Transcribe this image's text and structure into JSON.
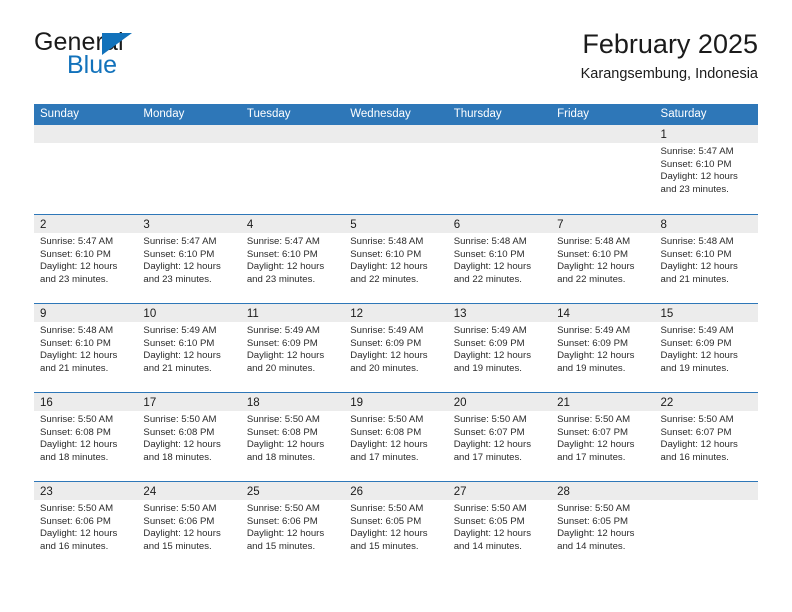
{
  "brand": {
    "name_part1": "General",
    "name_part2": "Blue",
    "accent_color": "#1272bb",
    "triangle_icon": "triangle-icon"
  },
  "header": {
    "title": "February 2025",
    "subtitle": "Karangsembung, Indonesia"
  },
  "calendar": {
    "header_color": "#2e77b8",
    "weekday_strip_color": "#ececec",
    "weekdays": [
      "Sunday",
      "Monday",
      "Tuesday",
      "Wednesday",
      "Thursday",
      "Friday",
      "Saturday"
    ],
    "weeks": [
      [
        {
          "day": "",
          "sunrise": "",
          "sunset": "",
          "daylight1": "",
          "daylight2": "",
          "empty": true
        },
        {
          "day": "",
          "sunrise": "",
          "sunset": "",
          "daylight1": "",
          "daylight2": "",
          "empty": true
        },
        {
          "day": "",
          "sunrise": "",
          "sunset": "",
          "daylight1": "",
          "daylight2": "",
          "empty": true
        },
        {
          "day": "",
          "sunrise": "",
          "sunset": "",
          "daylight1": "",
          "daylight2": "",
          "empty": true
        },
        {
          "day": "",
          "sunrise": "",
          "sunset": "",
          "daylight1": "",
          "daylight2": "",
          "empty": true
        },
        {
          "day": "",
          "sunrise": "",
          "sunset": "",
          "daylight1": "",
          "daylight2": "",
          "empty": true
        },
        {
          "day": "1",
          "sunrise": "Sunrise: 5:47 AM",
          "sunset": "Sunset: 6:10 PM",
          "daylight1": "Daylight: 12 hours",
          "daylight2": "and 23 minutes.",
          "empty": false
        }
      ],
      [
        {
          "day": "2",
          "sunrise": "Sunrise: 5:47 AM",
          "sunset": "Sunset: 6:10 PM",
          "daylight1": "Daylight: 12 hours",
          "daylight2": "and 23 minutes.",
          "empty": false
        },
        {
          "day": "3",
          "sunrise": "Sunrise: 5:47 AM",
          "sunset": "Sunset: 6:10 PM",
          "daylight1": "Daylight: 12 hours",
          "daylight2": "and 23 minutes.",
          "empty": false
        },
        {
          "day": "4",
          "sunrise": "Sunrise: 5:47 AM",
          "sunset": "Sunset: 6:10 PM",
          "daylight1": "Daylight: 12 hours",
          "daylight2": "and 23 minutes.",
          "empty": false
        },
        {
          "day": "5",
          "sunrise": "Sunrise: 5:48 AM",
          "sunset": "Sunset: 6:10 PM",
          "daylight1": "Daylight: 12 hours",
          "daylight2": "and 22 minutes.",
          "empty": false
        },
        {
          "day": "6",
          "sunrise": "Sunrise: 5:48 AM",
          "sunset": "Sunset: 6:10 PM",
          "daylight1": "Daylight: 12 hours",
          "daylight2": "and 22 minutes.",
          "empty": false
        },
        {
          "day": "7",
          "sunrise": "Sunrise: 5:48 AM",
          "sunset": "Sunset: 6:10 PM",
          "daylight1": "Daylight: 12 hours",
          "daylight2": "and 22 minutes.",
          "empty": false
        },
        {
          "day": "8",
          "sunrise": "Sunrise: 5:48 AM",
          "sunset": "Sunset: 6:10 PM",
          "daylight1": "Daylight: 12 hours",
          "daylight2": "and 21 minutes.",
          "empty": false
        }
      ],
      [
        {
          "day": "9",
          "sunrise": "Sunrise: 5:48 AM",
          "sunset": "Sunset: 6:10 PM",
          "daylight1": "Daylight: 12 hours",
          "daylight2": "and 21 minutes.",
          "empty": false
        },
        {
          "day": "10",
          "sunrise": "Sunrise: 5:49 AM",
          "sunset": "Sunset: 6:10 PM",
          "daylight1": "Daylight: 12 hours",
          "daylight2": "and 21 minutes.",
          "empty": false
        },
        {
          "day": "11",
          "sunrise": "Sunrise: 5:49 AM",
          "sunset": "Sunset: 6:09 PM",
          "daylight1": "Daylight: 12 hours",
          "daylight2": "and 20 minutes.",
          "empty": false
        },
        {
          "day": "12",
          "sunrise": "Sunrise: 5:49 AM",
          "sunset": "Sunset: 6:09 PM",
          "daylight1": "Daylight: 12 hours",
          "daylight2": "and 20 minutes.",
          "empty": false
        },
        {
          "day": "13",
          "sunrise": "Sunrise: 5:49 AM",
          "sunset": "Sunset: 6:09 PM",
          "daylight1": "Daylight: 12 hours",
          "daylight2": "and 19 minutes.",
          "empty": false
        },
        {
          "day": "14",
          "sunrise": "Sunrise: 5:49 AM",
          "sunset": "Sunset: 6:09 PM",
          "daylight1": "Daylight: 12 hours",
          "daylight2": "and 19 minutes.",
          "empty": false
        },
        {
          "day": "15",
          "sunrise": "Sunrise: 5:49 AM",
          "sunset": "Sunset: 6:09 PM",
          "daylight1": "Daylight: 12 hours",
          "daylight2": "and 19 minutes.",
          "empty": false
        }
      ],
      [
        {
          "day": "16",
          "sunrise": "Sunrise: 5:50 AM",
          "sunset": "Sunset: 6:08 PM",
          "daylight1": "Daylight: 12 hours",
          "daylight2": "and 18 minutes.",
          "empty": false
        },
        {
          "day": "17",
          "sunrise": "Sunrise: 5:50 AM",
          "sunset": "Sunset: 6:08 PM",
          "daylight1": "Daylight: 12 hours",
          "daylight2": "and 18 minutes.",
          "empty": false
        },
        {
          "day": "18",
          "sunrise": "Sunrise: 5:50 AM",
          "sunset": "Sunset: 6:08 PM",
          "daylight1": "Daylight: 12 hours",
          "daylight2": "and 18 minutes.",
          "empty": false
        },
        {
          "day": "19",
          "sunrise": "Sunrise: 5:50 AM",
          "sunset": "Sunset: 6:08 PM",
          "daylight1": "Daylight: 12 hours",
          "daylight2": "and 17 minutes.",
          "empty": false
        },
        {
          "day": "20",
          "sunrise": "Sunrise: 5:50 AM",
          "sunset": "Sunset: 6:07 PM",
          "daylight1": "Daylight: 12 hours",
          "daylight2": "and 17 minutes.",
          "empty": false
        },
        {
          "day": "21",
          "sunrise": "Sunrise: 5:50 AM",
          "sunset": "Sunset: 6:07 PM",
          "daylight1": "Daylight: 12 hours",
          "daylight2": "and 17 minutes.",
          "empty": false
        },
        {
          "day": "22",
          "sunrise": "Sunrise: 5:50 AM",
          "sunset": "Sunset: 6:07 PM",
          "daylight1": "Daylight: 12 hours",
          "daylight2": "and 16 minutes.",
          "empty": false
        }
      ],
      [
        {
          "day": "23",
          "sunrise": "Sunrise: 5:50 AM",
          "sunset": "Sunset: 6:06 PM",
          "daylight1": "Daylight: 12 hours",
          "daylight2": "and 16 minutes.",
          "empty": false
        },
        {
          "day": "24",
          "sunrise": "Sunrise: 5:50 AM",
          "sunset": "Sunset: 6:06 PM",
          "daylight1": "Daylight: 12 hours",
          "daylight2": "and 15 minutes.",
          "empty": false
        },
        {
          "day": "25",
          "sunrise": "Sunrise: 5:50 AM",
          "sunset": "Sunset: 6:06 PM",
          "daylight1": "Daylight: 12 hours",
          "daylight2": "and 15 minutes.",
          "empty": false
        },
        {
          "day": "26",
          "sunrise": "Sunrise: 5:50 AM",
          "sunset": "Sunset: 6:05 PM",
          "daylight1": "Daylight: 12 hours",
          "daylight2": "and 15 minutes.",
          "empty": false
        },
        {
          "day": "27",
          "sunrise": "Sunrise: 5:50 AM",
          "sunset": "Sunset: 6:05 PM",
          "daylight1": "Daylight: 12 hours",
          "daylight2": "and 14 minutes.",
          "empty": false
        },
        {
          "day": "28",
          "sunrise": "Sunrise: 5:50 AM",
          "sunset": "Sunset: 6:05 PM",
          "daylight1": "Daylight: 12 hours",
          "daylight2": "and 14 minutes.",
          "empty": false
        },
        {
          "day": "",
          "sunrise": "",
          "sunset": "",
          "daylight1": "",
          "daylight2": "",
          "empty": true
        }
      ]
    ]
  }
}
